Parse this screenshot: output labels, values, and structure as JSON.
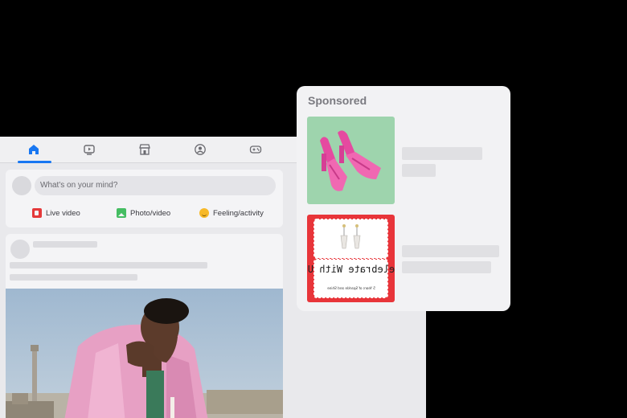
{
  "nav": {
    "items": [
      {
        "name": "home-icon",
        "active": true
      },
      {
        "name": "video-icon",
        "active": false
      },
      {
        "name": "marketplace-icon",
        "active": false
      },
      {
        "name": "groups-icon",
        "active": false
      },
      {
        "name": "gaming-icon",
        "active": false
      }
    ]
  },
  "composer": {
    "placeholder": "What's on your mind?",
    "actions": [
      {
        "label": "Live video",
        "icon": "live-video-icon",
        "color": "#e4393a"
      },
      {
        "label": "Photo/video",
        "icon": "photo-icon",
        "color": "#45bd62"
      },
      {
        "label": "Feeling/activity",
        "icon": "feeling-icon",
        "color": "#f7b928"
      }
    ]
  },
  "sponsored": {
    "title": "Sponsored",
    "ads": [
      {
        "name": "pink-sandals-ad"
      },
      {
        "name": "celebrate-earrings-ad",
        "headline": "Celebrate With Us",
        "subline": "5 Years of Sparkle and Shine"
      }
    ]
  },
  "colors": {
    "accent": "#1877f2",
    "background": "#000000"
  }
}
